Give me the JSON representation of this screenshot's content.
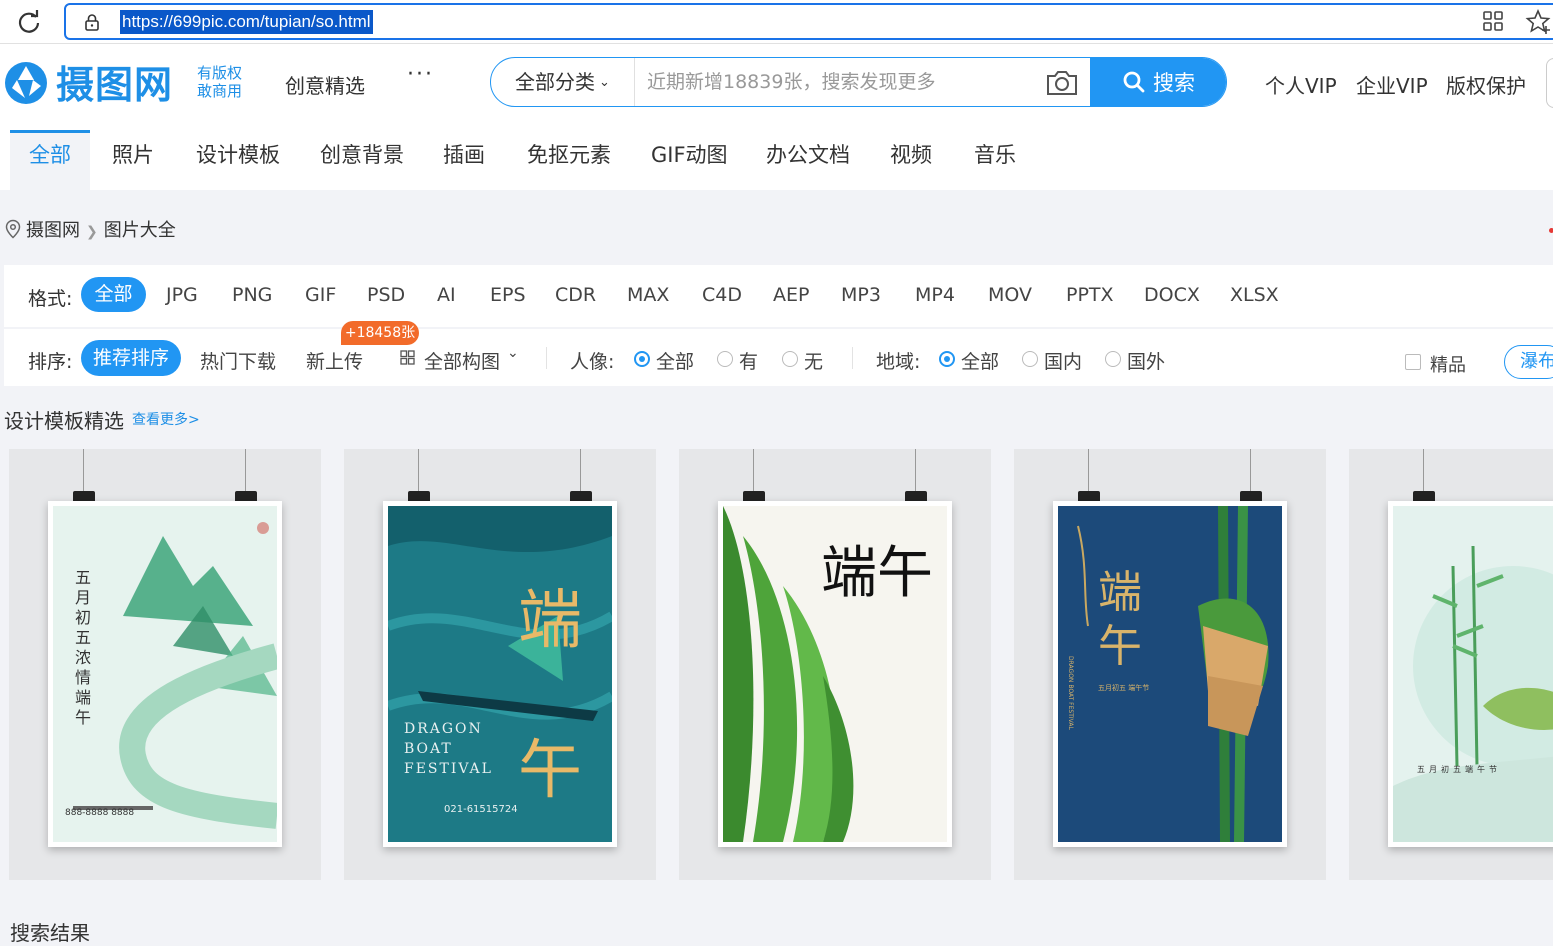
{
  "browser": {
    "url": "https://699pic.com/tupian/so.html"
  },
  "header": {
    "logo_text": "摄图网",
    "logo_sub_line1": "有版权",
    "logo_sub_line2": "敢商用",
    "nav_creative": "创意精选",
    "nav_more": "···",
    "search_category": "全部分类",
    "search_placeholder": "近期新增18839张，搜索发现更多",
    "search_button": "搜索",
    "links": [
      "个人VIP",
      "企业VIP",
      "版权保护"
    ]
  },
  "tabs": [
    "全部",
    "照片",
    "设计模板",
    "创意背景",
    "插画",
    "免抠元素",
    "GIF动图",
    "办公文档",
    "视频",
    "音乐"
  ],
  "breadcrumb": {
    "home": "摄图网",
    "current": "图片大全"
  },
  "format_filter": {
    "label": "格式:",
    "active": "全部",
    "options": [
      "JPG",
      "PNG",
      "GIF",
      "PSD",
      "AI",
      "EPS",
      "CDR",
      "MAX",
      "C4D",
      "AEP",
      "MP3",
      "MP4",
      "MOV",
      "PPTX",
      "DOCX",
      "XLSX"
    ]
  },
  "sort_filter": {
    "label": "排序:",
    "active": "推荐排序",
    "hot": "热门下载",
    "new": "新上传",
    "badge": "+18458张",
    "composition": "全部构图",
    "portrait_label": "人像:",
    "portrait_options": [
      "全部",
      "有",
      "无"
    ],
    "region_label": "地域:",
    "region_options": [
      "全部",
      "国内",
      "国外"
    ],
    "premium": "精品",
    "waterfall": "瀑布"
  },
  "section": {
    "title": "设计模板精选",
    "more": "查看更多>"
  },
  "posters": [
    {
      "title": "五月初五 浓情端午",
      "phone": "888-8888 8888",
      "bg": "#e6f3ee"
    },
    {
      "title": "端午",
      "en1": "DRAGON",
      "en2": "BOAT",
      "en3": "FESTIVAL",
      "phone": "021-61515724",
      "bg": "#1d7a86"
    },
    {
      "title": "端午",
      "bg": "#f6f5ef"
    },
    {
      "title": "端午",
      "en": "DRAGON BOAT FESTIVAL",
      "sub": "五月初五 端午节",
      "bg": "#1c4a7a"
    },
    {
      "title": "五月初五端午节",
      "bg": "#e4f2ee"
    }
  ],
  "results_title": "搜索结果"
}
